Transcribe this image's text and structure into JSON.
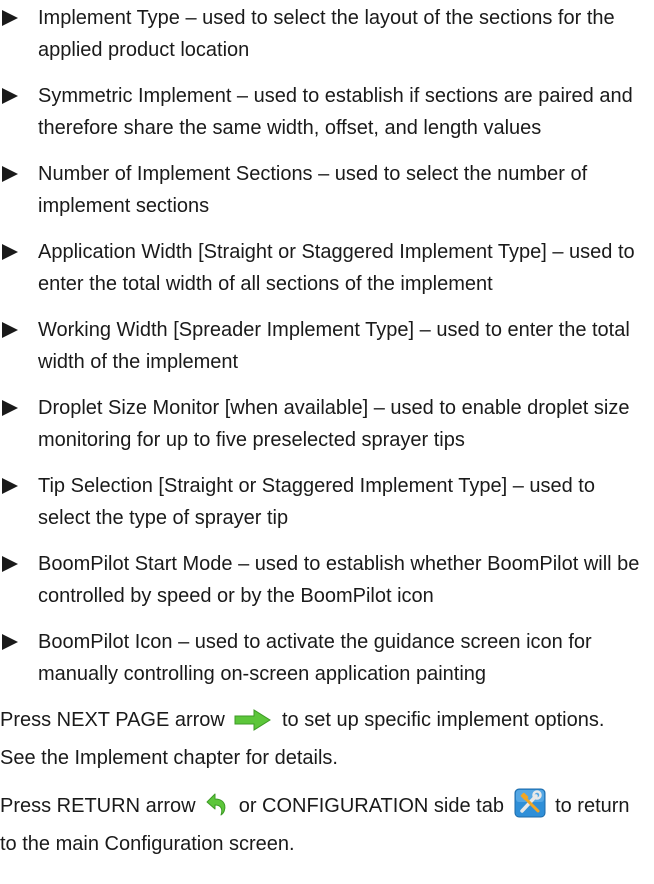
{
  "bullets": [
    "Implement Type – used to select the layout of the sections for the applied product location",
    "Symmetric Implement – used to establish if sections are paired and therefore share the same width, offset, and length values",
    "Number of Implement Sections – used to select the number of implement sections",
    "Application Width [Straight or Staggered Implement Type] – used to enter the total width of all sections of the implement",
    "Working Width [Spreader Implement Type] – used to enter the total width of the implement",
    "Droplet Size Monitor [when available] – used to enable droplet size monitoring for up to five preselected sprayer tips",
    "Tip Selection [Straight or Staggered Implement Type] – used to select the type of sprayer tip",
    "BoomPilot Start Mode – used to establish whether BoomPilot will be controlled by speed or by the BoomPilot icon",
    "BoomPilot Icon – used to activate the guidance screen icon for manually controlling on-screen application painting"
  ],
  "next_page": {
    "before": "Press NEXT PAGE arrow",
    "after": "to set up specific implement options. See the Implement chapter for details.",
    "icon": "next-page-arrow-icon",
    "icon_color": "#5cc63a"
  },
  "return": {
    "before": "Press RETURN arrow",
    "middle": "or CONFIGURATION side tab",
    "after": "to return to the main Configuration screen.",
    "return_icon": "return-arrow-icon",
    "return_icon_color": "#5cc63a",
    "config_icon": "configuration-tools-icon",
    "config_icon_color": "#2f8fd8"
  }
}
